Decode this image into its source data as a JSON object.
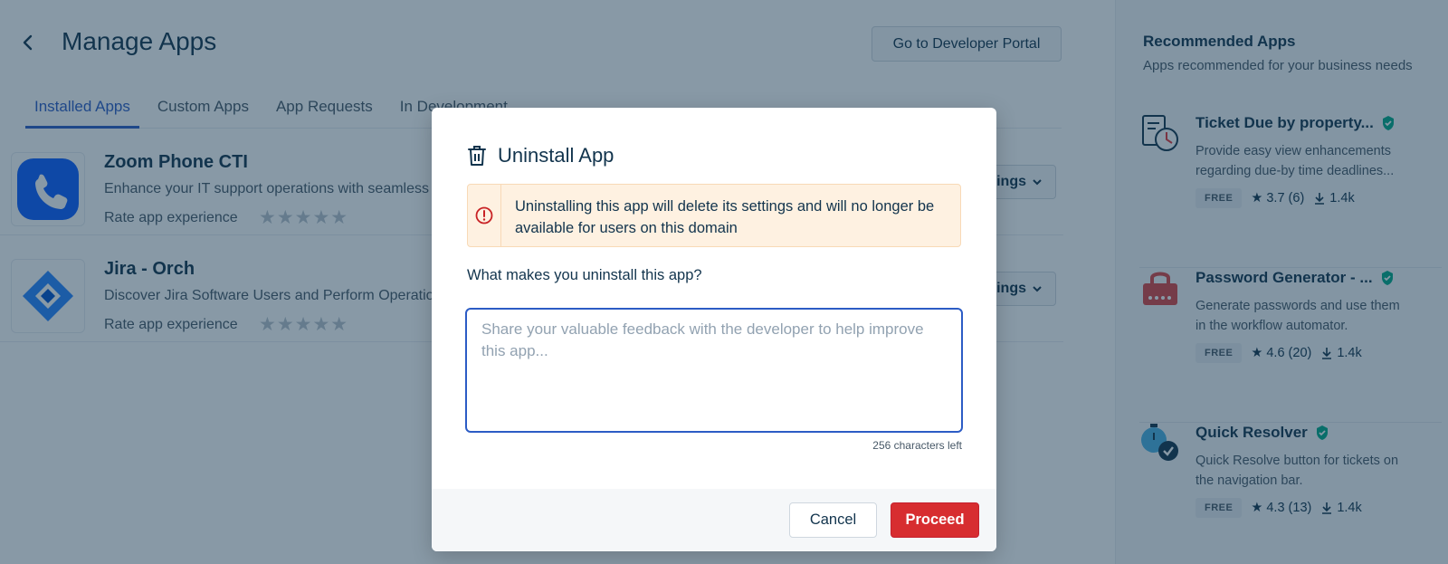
{
  "page": {
    "title": "Manage Apps",
    "dev_portal_label": "Go to Developer Portal",
    "tabs": [
      {
        "label": "Installed Apps"
      },
      {
        "label": "Custom Apps"
      },
      {
        "label": "App Requests"
      },
      {
        "label": "In Development"
      }
    ],
    "apps": [
      {
        "name": "Zoom Phone CTI",
        "description": "Enhance your IT support operations with seamless Zoom Phone integration and Perform Operations",
        "rate_label": "Rate app experience",
        "stars": "★★★★★",
        "settings_label": "Settings",
        "icon": "phone-icon"
      },
      {
        "name": "Jira - Orch",
        "description": "Discover Jira Software Users and Perform Operations",
        "rate_label": "Rate app experience",
        "stars": "★★★★★",
        "settings_label": "Settings",
        "icon": "jira-icon"
      }
    ]
  },
  "sidebar": {
    "title": "Recommended Apps",
    "subtitle": "Apps recommended for your business needs",
    "apps": [
      {
        "name": "Ticket Due by property...",
        "description": "Provide easy view enhancements regarding due-by time deadlines...",
        "badge": "FREE",
        "rating": "★ 3.7 (6)",
        "installs": "1.4k",
        "icon": "ticket-due-icon"
      },
      {
        "name": "Password Generator - ...",
        "description": "Generate passwords and use them in the workflow automator.",
        "badge": "FREE",
        "rating": "★ 4.6 (20)",
        "installs": "1.4k",
        "icon": "lock-icon"
      },
      {
        "name": "Quick Resolver",
        "description": "Quick Resolve button for tickets on the navigation bar.",
        "badge": "FREE",
        "rating": "★ 4.3 (13)",
        "installs": "1.4k",
        "icon": "stopwatch-check-icon"
      }
    ]
  },
  "modal": {
    "title": "Uninstall App",
    "warning": "Uninstalling this app will delete its settings and will no longer be available for users on this domain",
    "question": "What makes you uninstall this app?",
    "feedback_placeholder": "Share your valuable feedback with the developer to help improve this app...",
    "feedback_value": "",
    "char_count": "256 characters left",
    "cancel_label": "Cancel",
    "proceed_label": "Proceed"
  },
  "colors": {
    "accent": "#2c5cc5",
    "danger": "#d72d30",
    "warning_bg": "#fef1e1",
    "overlay": "rgba(18,52,77,0.5)",
    "verified": "#00a886"
  }
}
